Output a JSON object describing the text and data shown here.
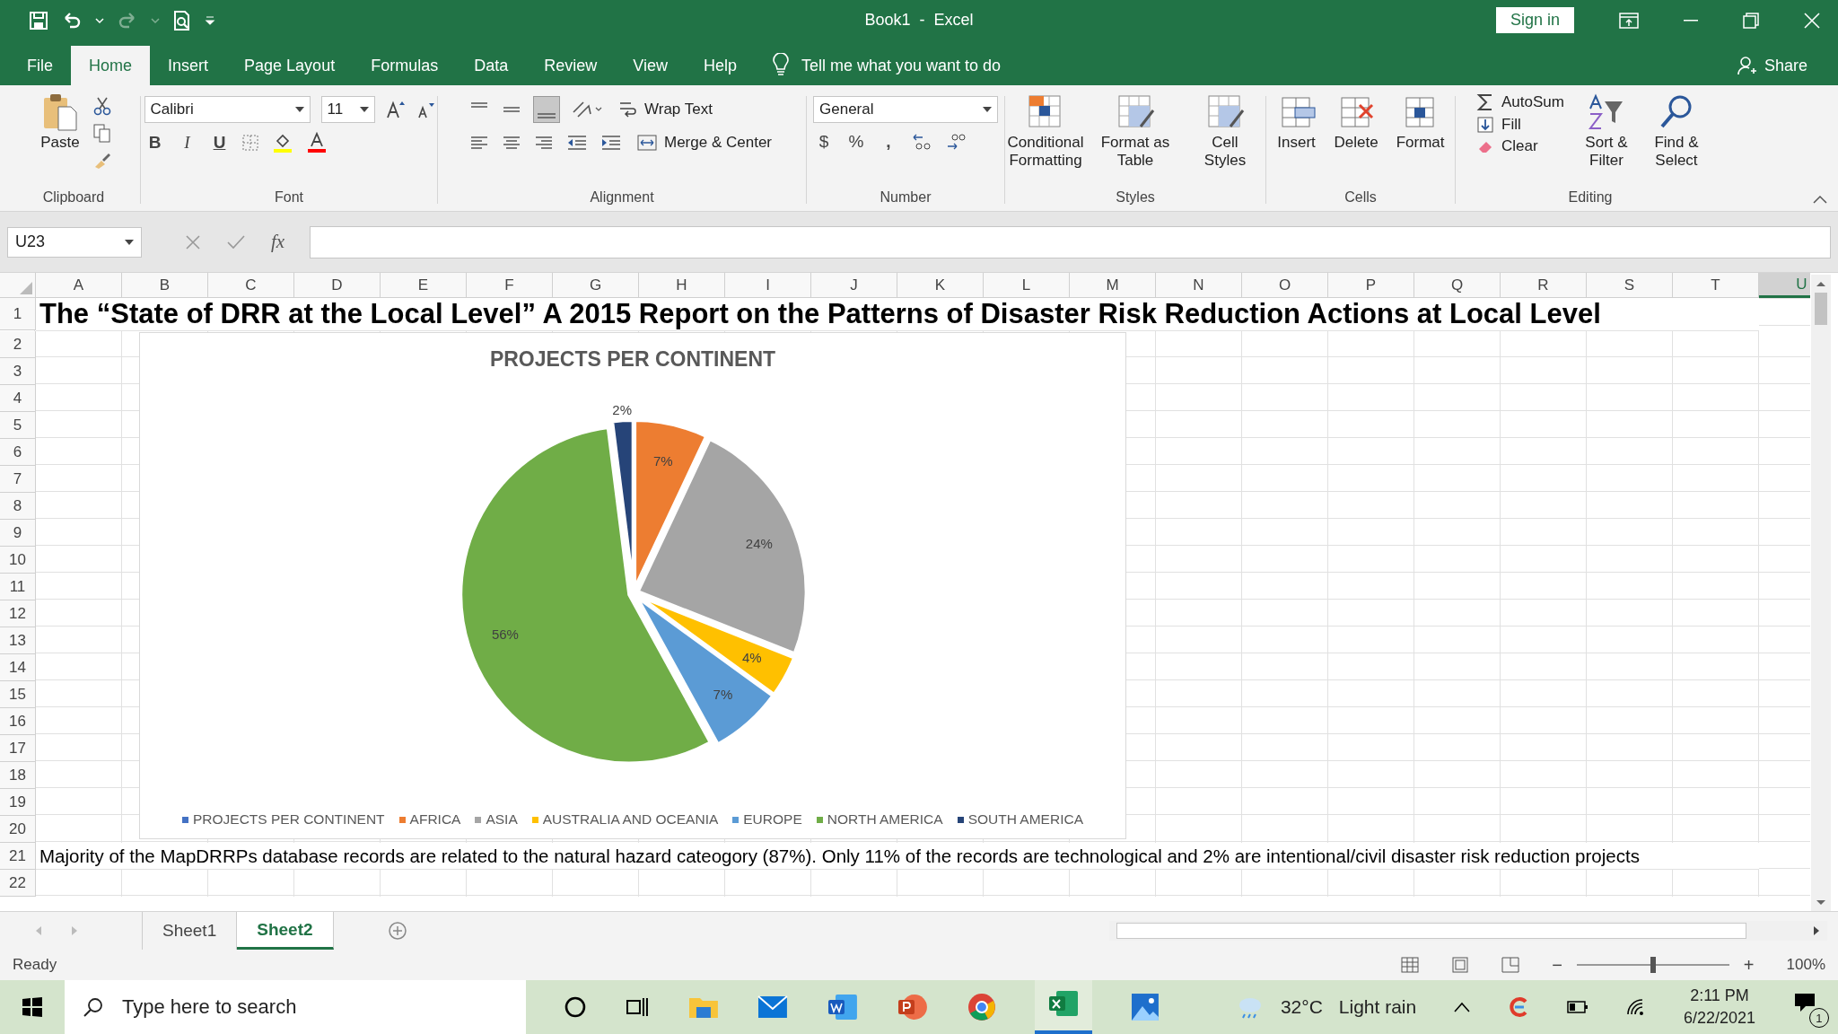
{
  "title_bar": {
    "title": "Book1  -  Excel",
    "sign_in": "Sign in"
  },
  "menu_tabs": [
    {
      "label": "File",
      "selected": false
    },
    {
      "label": "Home",
      "selected": true
    },
    {
      "label": "Insert",
      "selected": false
    },
    {
      "label": "Page Layout",
      "selected": false
    },
    {
      "label": "Formulas",
      "selected": false
    },
    {
      "label": "Data",
      "selected": false
    },
    {
      "label": "Review",
      "selected": false
    },
    {
      "label": "View",
      "selected": false
    },
    {
      "label": "Help",
      "selected": false
    }
  ],
  "tell_me": "Tell me what you want to do",
  "share": "Share",
  "ribbon": {
    "clipboard": {
      "paste": "Paste",
      "label": "Clipboard"
    },
    "font": {
      "font_name": "Calibri",
      "font_size": "11",
      "bold": "B",
      "italic": "I",
      "underline": "U",
      "label": "Font"
    },
    "alignment": {
      "wrap_text": "Wrap Text",
      "merge_center": "Merge & Center",
      "label": "Alignment"
    },
    "number": {
      "format": "General",
      "currency": "$",
      "percent": "%",
      "comma": ",",
      "label": "Number"
    },
    "styles": {
      "buttons": [
        "Conditional Formatting",
        "Format as Table",
        "Cell Styles"
      ],
      "label": "Styles"
    },
    "cells": {
      "buttons": [
        "Insert",
        "Delete",
        "Format"
      ],
      "label": "Cells"
    },
    "editing": {
      "autosum": "AutoSum",
      "fill": "Fill",
      "clear": "Clear",
      "sort_filter": "Sort & Filter",
      "find_select": "Find & Select",
      "label": "Editing"
    }
  },
  "formula_bar": {
    "name_box": "U23",
    "function_label": "fx"
  },
  "sheet": {
    "columns": [
      {
        "label": "A",
        "selected": false
      },
      {
        "label": "B",
        "selected": false
      },
      {
        "label": "C",
        "selected": false
      },
      {
        "label": "D",
        "selected": false
      },
      {
        "label": "E",
        "selected": false
      },
      {
        "label": "F",
        "selected": false
      },
      {
        "label": "G",
        "selected": false
      },
      {
        "label": "H",
        "selected": false
      },
      {
        "label": "I",
        "selected": false
      },
      {
        "label": "J",
        "selected": false
      },
      {
        "label": "K",
        "selected": false
      },
      {
        "label": "L",
        "selected": false
      },
      {
        "label": "M",
        "selected": false
      },
      {
        "label": "N",
        "selected": false
      },
      {
        "label": "O",
        "selected": false
      },
      {
        "label": "P",
        "selected": false
      },
      {
        "label": "Q",
        "selected": false
      },
      {
        "label": "R",
        "selected": false
      },
      {
        "label": "S",
        "selected": false
      },
      {
        "label": "T",
        "selected": false
      },
      {
        "label": "U",
        "selected": true
      }
    ],
    "rows": [
      "1",
      "2",
      "3",
      "4",
      "5",
      "6",
      "7",
      "8",
      "9",
      "10",
      "11",
      "12",
      "13",
      "14",
      "15",
      "16",
      "17",
      "18",
      "19",
      "20",
      "21",
      "22"
    ],
    "title_cell": "The “State of DRR at the Local Level” A 2015 Report on the Patterns of Disaster Risk Reduction Actions at Local Level",
    "note_cell": "Majority of the MapDRRPs database records are related to the natural hazard cateogory (87%). Only 11% of the records are technological and 2% are intentional/civil disaster risk reduction projects"
  },
  "chart": {
    "chart_data": {
      "type": "pie",
      "title": "PROJECTS PER CONTINENT",
      "legend": "bottom",
      "categories": [
        "PROJECTS PER CONTINENT",
        "AFRICA",
        "ASIA",
        "AUSTRALIA AND OCEANIA",
        "EUROPE",
        "NORTH AMERICA",
        "SOUTH AMERICA"
      ],
      "values": [
        0,
        7,
        24,
        4,
        7,
        56,
        2
      ],
      "colors": [
        "#4472c4",
        "#ed7d31",
        "#a5a5a5",
        "#ffc000",
        "#5b9bd5",
        "#70ad47",
        "#264478"
      ],
      "value_labels": [
        null,
        "7%",
        "24%",
        "4%",
        "7%",
        "56%",
        "2%"
      ]
    }
  },
  "sheet_tabs": [
    {
      "label": "Sheet1",
      "selected": false
    },
    {
      "label": "Sheet2",
      "selected": true
    }
  ],
  "status_bar": {
    "status": "Ready",
    "zoom_out": "−",
    "zoom_slider": {
      "level": 0.5
    },
    "zoom_in": "+",
    "zoom": "100%"
  },
  "taskbar": {
    "search_placeholder": "Type here to search",
    "temperature": "32°C",
    "weather": "Light rain",
    "time": "2:11 PM",
    "date": "6/22/2021",
    "notifications": "1"
  }
}
